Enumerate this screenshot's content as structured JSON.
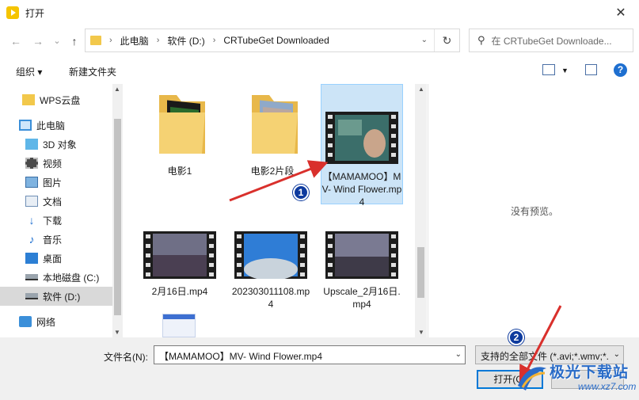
{
  "window": {
    "title": "打开",
    "close_icon": "close-icon"
  },
  "nav": {
    "back_icon": "←",
    "forward_icon": "→",
    "recent_icon": "⌄",
    "up_icon": "↑",
    "breadcrumbs": [
      "此电脑",
      "软件 (D:)",
      "CRTubeGet Downloaded"
    ],
    "search_placeholder": "在 CRTubeGet Downloade..."
  },
  "toolbar": {
    "organize": "组织 ▾",
    "new_folder": "新建文件夹"
  },
  "sidebar": {
    "items": [
      {
        "label": "WPS云盘",
        "icon": "folder-icon"
      },
      {
        "label": "此电脑",
        "icon": "computer-icon"
      },
      {
        "label": "3D 对象",
        "icon": "3d-objects-icon"
      },
      {
        "label": "视频",
        "icon": "video-icon"
      },
      {
        "label": "图片",
        "icon": "pictures-icon"
      },
      {
        "label": "文档",
        "icon": "documents-icon"
      },
      {
        "label": "下载",
        "icon": "download-icon"
      },
      {
        "label": "音乐",
        "icon": "music-icon"
      },
      {
        "label": "桌面",
        "icon": "desktop-icon"
      },
      {
        "label": "本地磁盘 (C:)",
        "icon": "drive-icon"
      },
      {
        "label": "软件 (D:)",
        "icon": "drive-icon"
      },
      {
        "label": "网络",
        "icon": "network-icon"
      }
    ]
  },
  "files": [
    {
      "name": "电影1",
      "type": "folder"
    },
    {
      "name": "电影2片段",
      "type": "folder"
    },
    {
      "name": "【MAMAMOO】MV- Wind Flower.mp4",
      "type": "video"
    },
    {
      "name": "2月16日.mp4",
      "type": "video"
    },
    {
      "name": "202303011108.mp4",
      "type": "video"
    },
    {
      "name": "Upscale_2月16日.mp4",
      "type": "video"
    }
  ],
  "preview": {
    "empty_text": "没有预览。"
  },
  "bottom": {
    "filename_label": "文件名(N):",
    "filename_value": "【MAMAMOO】MV- Wind Flower.mp4",
    "filter_value": "支持的全部文件 (*.avi;*.wmv;*.",
    "open_button": "打开(O)"
  },
  "annotations": {
    "marker1": "1",
    "marker2": "2",
    "arrow_color": "#d9302c"
  },
  "watermark": {
    "text": "极光下载站",
    "url": "www.xz7.com"
  }
}
